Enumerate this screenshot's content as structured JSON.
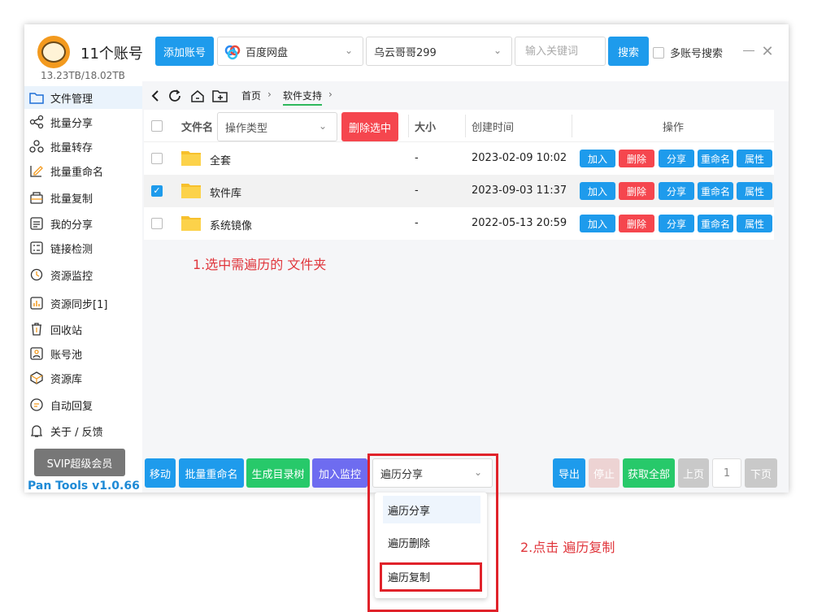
{
  "header": {
    "account_count": "11个账号",
    "storage": "13.23TB/18.02TB",
    "add_account": "添加账号",
    "disk": "百度网盘",
    "user": "乌云哥哥299",
    "keyword_placeholder": "输入关键词",
    "search": "搜索",
    "multi_search": "多账号搜索"
  },
  "sidebar": {
    "items": [
      {
        "label": "文件管理",
        "icon": "folder-icon"
      },
      {
        "label": "批量分享",
        "icon": "share-icon"
      },
      {
        "label": "批量转存",
        "icon": "transfer-icon"
      },
      {
        "label": "批量重命名",
        "icon": "rename-icon"
      },
      {
        "label": "批量复制",
        "icon": "copy-icon"
      },
      {
        "label": "我的分享",
        "icon": "my-share-icon"
      },
      {
        "label": "链接检测",
        "icon": "link-check-icon"
      },
      {
        "label": "资源监控",
        "icon": "monitor-icon"
      },
      {
        "label": "资源同步[1]",
        "icon": "sync-icon"
      },
      {
        "label": "回收站",
        "icon": "trash-icon"
      },
      {
        "label": "账号池",
        "icon": "account-pool-icon"
      },
      {
        "label": "资源库",
        "icon": "library-icon"
      },
      {
        "label": "自动回复",
        "icon": "auto-reply-icon"
      },
      {
        "label": "关于 / 反馈",
        "icon": "bell-icon"
      }
    ],
    "svip": "SVIP超级会员",
    "version": "Pan Tools v1.0.66"
  },
  "breadcrumb": {
    "home": "首页",
    "current": "软件支持"
  },
  "table": {
    "headers": {
      "name": "文件名",
      "op_type": "操作类型",
      "delete_selected": "删除选中",
      "size": "大小",
      "created": "创建时间",
      "actions": "操作"
    },
    "rows": [
      {
        "name": "全套",
        "size": "-",
        "created": "2023-02-09 10:02",
        "checked": false
      },
      {
        "name": "软件库",
        "size": "-",
        "created": "2023-09-03 11:37",
        "checked": true
      },
      {
        "name": "系统镜像",
        "size": "-",
        "created": "2022-05-13 20:59",
        "checked": false
      }
    ],
    "row_actions": {
      "add": "加入",
      "delete": "删除",
      "share": "分享",
      "rename": "重命名",
      "props": "属性"
    }
  },
  "annotations": {
    "step1": "1.选中需遍历的 文件夹",
    "step2": "2.点击 遍历复制"
  },
  "bottom": {
    "move": "移动",
    "batch_rename": "批量重命名",
    "gen_tree": "生成目录树",
    "add_monitor": "加入监控",
    "traverse_selected": "遍历分享",
    "export": "导出",
    "stop": "停止",
    "get_all": "获取全部",
    "prev": "上页",
    "page": "1",
    "next": "下页"
  },
  "dropdown": {
    "options": [
      "遍历分享",
      "遍历删除",
      "遍历复制"
    ]
  },
  "colors": {
    "primary": "#1e9bec",
    "danger": "#f5464e",
    "success": "#27c96a",
    "annotation": "#e0222a"
  }
}
